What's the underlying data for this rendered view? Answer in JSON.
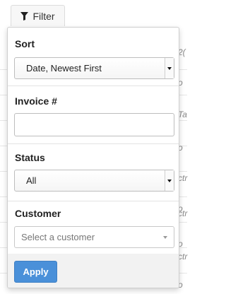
{
  "filter_button": {
    "label": "Filter",
    "icon": "funnel-icon"
  },
  "sort": {
    "label": "Sort",
    "selected": "Date, Newest First"
  },
  "invoice": {
    "label": "Invoice #",
    "value": ""
  },
  "status": {
    "label": "Status",
    "selected": "All"
  },
  "customer": {
    "label": "Customer",
    "placeholder": "Select a customer"
  },
  "apply_button": {
    "label": "Apply",
    "color": "#4a90d9"
  },
  "background_fragments": [
    "2(",
    "o",
    "Ta",
    "o",
    "ctr",
    "o",
    "ctr",
    "o",
    "ctr",
    "o"
  ]
}
